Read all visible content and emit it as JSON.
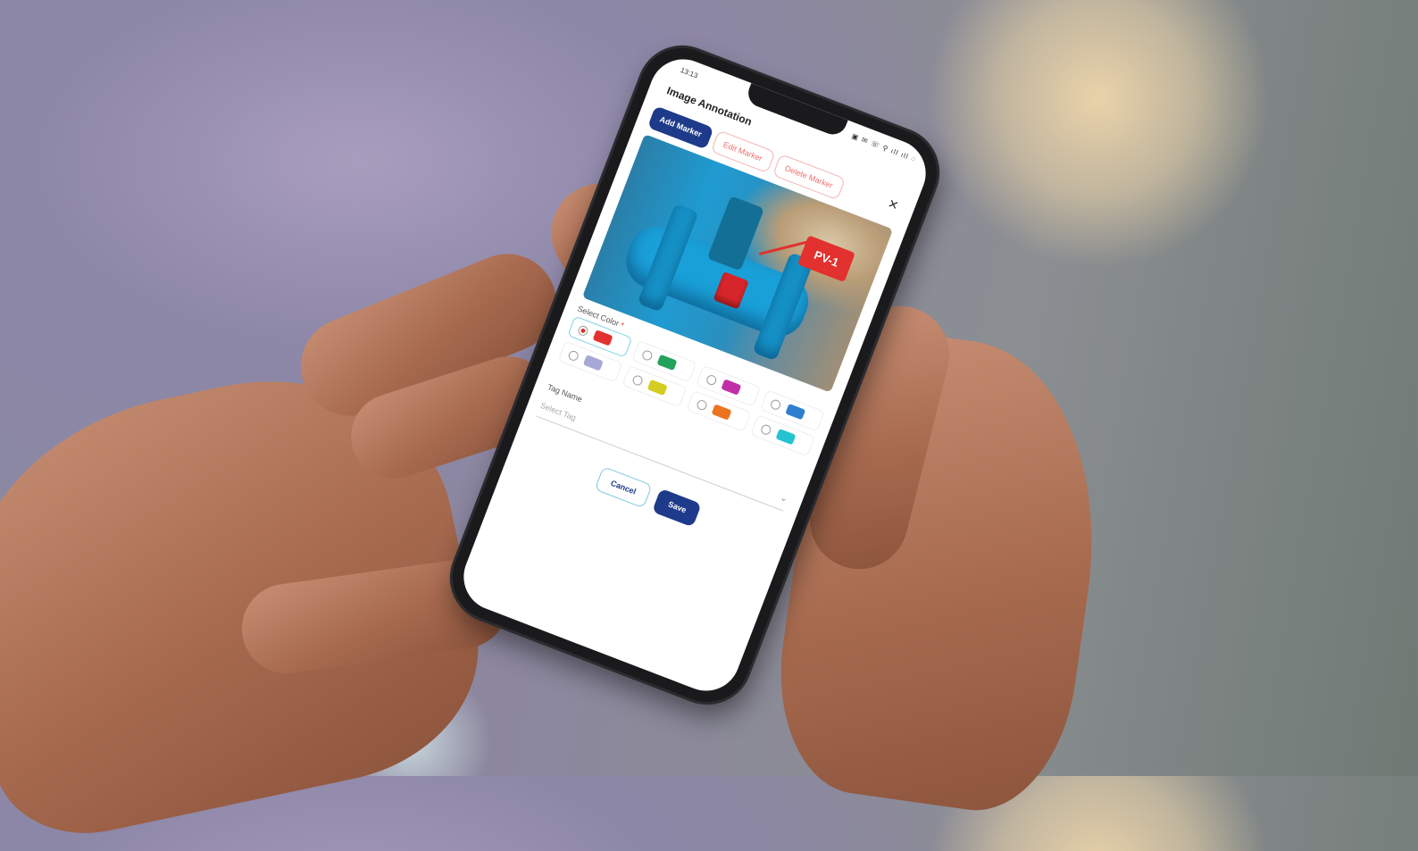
{
  "status": {
    "time": "13:13",
    "icons": "▣ ✉ ☏ ⚲ ıll ıll ◌"
  },
  "header": {
    "title": "Image Annotation",
    "close_icon": "close-icon"
  },
  "toolbar": {
    "add_marker": "Add Marker",
    "edit_marker": "Edit Marker",
    "delete_marker": "Delete Marker"
  },
  "image": {
    "marker_label": "PV-1"
  },
  "color_section": {
    "label": "Select Color",
    "required_mark": "*",
    "selected_index": 0,
    "options": [
      {
        "color": "#e2312e"
      },
      {
        "color": "#23a35a"
      },
      {
        "color": "#c12fa8"
      },
      {
        "color": "#2f7fd1"
      },
      {
        "color": "#a6a9d6"
      },
      {
        "color": "#d4cc22"
      },
      {
        "color": "#ec7320"
      },
      {
        "color": "#25c2cf"
      }
    ]
  },
  "tag_section": {
    "label": "Tag Name",
    "placeholder": "Select Tag",
    "dropdown_icon": "chevron-down-icon"
  },
  "actions": {
    "cancel": "Cancel",
    "save": "Save"
  }
}
